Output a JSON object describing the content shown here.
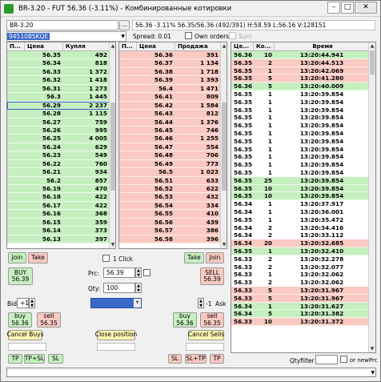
{
  "window": {
    "title": "BR-3.20 - FUT 56.36 (-3.11%) - Комбинированные котировки",
    "minimize": "–",
    "maximize": "□",
    "close": "✕"
  },
  "toolbar": {
    "instrument": "BR-3.20",
    "dropdown": "...",
    "info": "56.36  -3.11%  56.35/56.36  (492/391)  H:58.59  L:56.16  V:128151",
    "account": "94510BSKQE",
    "spread": "Spread: 0.01",
    "own_orders": "Own orders",
    "sum": "Sum"
  },
  "buy_book": {
    "headers": {
      "p": "П...",
      "price": "Цена",
      "qty": "Купля"
    },
    "rows": [
      [
        "56.35",
        "492"
      ],
      [
        "56.34",
        "818"
      ],
      [
        "56.33",
        "1 372"
      ],
      [
        "56.32",
        "1 418"
      ],
      [
        "56.31",
        "1 273"
      ],
      [
        "56.3",
        "1 445"
      ],
      [
        "56.29",
        "2 237"
      ],
      [
        "56.28",
        "1 115"
      ],
      [
        "56.27",
        "759"
      ],
      [
        "56.26",
        "995"
      ],
      [
        "56.25",
        "4 005"
      ],
      [
        "56.24",
        "629"
      ],
      [
        "56.23",
        "549"
      ],
      [
        "56.22",
        "760"
      ],
      [
        "56.21",
        "934"
      ],
      [
        "56.2",
        "857"
      ],
      [
        "56.19",
        "470"
      ],
      [
        "56.18",
        "422"
      ],
      [
        "56.17",
        "422"
      ],
      [
        "56.16",
        "368"
      ],
      [
        "56.15",
        "359"
      ],
      [
        "56.14",
        "373"
      ],
      [
        "56.13",
        "397"
      ]
    ]
  },
  "sell_book": {
    "headers": {
      "p": "П...",
      "price": "Цена",
      "qty": "Продажа"
    },
    "rows": [
      [
        "56.36",
        "391"
      ],
      [
        "56.37",
        "1 134"
      ],
      [
        "56.38",
        "1 718"
      ],
      [
        "56.39",
        "1 393"
      ],
      [
        "56.4",
        "1 471"
      ],
      [
        "56.41",
        "809"
      ],
      [
        "56.42",
        "1 584"
      ],
      [
        "56.43",
        "812"
      ],
      [
        "56.44",
        "1 376"
      ],
      [
        "56.45",
        "746"
      ],
      [
        "56.46",
        "1 255"
      ],
      [
        "56.47",
        "554"
      ],
      [
        "56.48",
        "706"
      ],
      [
        "56.49",
        "773"
      ],
      [
        "56.5",
        "1 023"
      ],
      [
        "56.51",
        "633"
      ],
      [
        "56.52",
        "622"
      ],
      [
        "56.53",
        "432"
      ],
      [
        "56.54",
        "334"
      ],
      [
        "56.55",
        "410"
      ],
      [
        "56.56",
        "439"
      ],
      [
        "56.57",
        "386"
      ],
      [
        "56.58",
        "396"
      ]
    ]
  },
  "trades": {
    "headers": {
      "p": "Це...",
      "n": "Ко...",
      "time": "Время"
    },
    "rows": [
      [
        "56.36",
        "10",
        "13:20:44.941",
        "g"
      ],
      [
        "56.35",
        "2",
        "13:20:44.513",
        "r"
      ],
      [
        "56.35",
        "1",
        "13:20:42.069",
        "r"
      ],
      [
        "56.35",
        "5",
        "13:20:41.280",
        "r"
      ],
      [
        "56.36",
        "5",
        "13:20:40.009",
        "g"
      ],
      [
        "56.35",
        "1",
        "13:20:39.854",
        "w"
      ],
      [
        "56.35",
        "1",
        "13:20:39.854",
        "w"
      ],
      [
        "56.35",
        "1",
        "13:20:39.854",
        "w"
      ],
      [
        "56.35",
        "1",
        "13:20:39.854",
        "w"
      ],
      [
        "56.35",
        "1",
        "13:20:39.854",
        "w"
      ],
      [
        "56.35",
        "1",
        "13:20:39.854",
        "w"
      ],
      [
        "56.35",
        "1",
        "13:20:39.854",
        "w"
      ],
      [
        "56.35",
        "1",
        "13:20:39.854",
        "w"
      ],
      [
        "56.35",
        "1",
        "13:20:39.854",
        "w"
      ],
      [
        "56.35",
        "1",
        "13:20:39.854",
        "w"
      ],
      [
        "56.35",
        "1",
        "13:20:39.854",
        "w"
      ],
      [
        "56.35",
        "25",
        "13:20:39.854",
        "g"
      ],
      [
        "56.35",
        "10",
        "13:20:39.854",
        "g"
      ],
      [
        "56.35",
        "10",
        "13:20:39.854",
        "g"
      ],
      [
        "56.34",
        "1",
        "13:20:37.917",
        "w"
      ],
      [
        "56.34",
        "1",
        "13:20:36.001",
        "w"
      ],
      [
        "56.35",
        "1",
        "13:20:35.472",
        "w"
      ],
      [
        "56.34",
        "2",
        "13:20:34.416",
        "w"
      ],
      [
        "56.34",
        "2",
        "13:20:33.112",
        "w"
      ],
      [
        "56.34",
        "20",
        "13:20:32.685",
        "r"
      ],
      [
        "56.35",
        "1",
        "13:20:32.410",
        "g"
      ],
      [
        "56.33",
        "2",
        "13:20:32.278",
        "w"
      ],
      [
        "56.33",
        "2",
        "13:20:32.077",
        "w"
      ],
      [
        "56.33",
        "1",
        "13:20:32.062",
        "w"
      ],
      [
        "56.33",
        "2",
        "13:20:32.062",
        "w"
      ],
      [
        "56.33",
        "5",
        "13:20:31.967",
        "r"
      ],
      [
        "56.33",
        "5",
        "13:20:31.967",
        "r"
      ],
      [
        "56.34",
        "1",
        "13:20:31.627",
        "g"
      ],
      [
        "56.34",
        "5",
        "13:20:31.382",
        "g"
      ],
      [
        "56.33",
        "10",
        "13:20:31.372",
        "r"
      ]
    ]
  },
  "controls": {
    "join": "Join",
    "take": "Take",
    "one_click": "1 Click",
    "buy_main": "BUY\n56.39",
    "sell_main": "SELL\n56.39",
    "prc_label": "Prc:",
    "prc_value": "56.39",
    "qty_label": "Qty:",
    "qty_value": "100",
    "bid_label": "Bid",
    "bid_value": "+1",
    "ask_label": "Ask",
    "ask_value": "-1",
    "buy_small_left": "buy\n56.36",
    "sell_small_left": "sell\n56.35",
    "buy_small_right": "buy\n56.36",
    "sell_small_right": "sell\n56.35",
    "cancel_buys": "Cancel Buys",
    "close_position": "Close position",
    "cancel_sells": "Cancel Sells",
    "tp": "TP",
    "tp_sl": "TP+SL",
    "sl": "SL",
    "sl_tp": "SL+TP",
    "tp2": "TP",
    "sl2": "SL"
  },
  "footer": {
    "qtyfilter_label": "Qtyfilter",
    "or_newprc": "or newPrc"
  }
}
